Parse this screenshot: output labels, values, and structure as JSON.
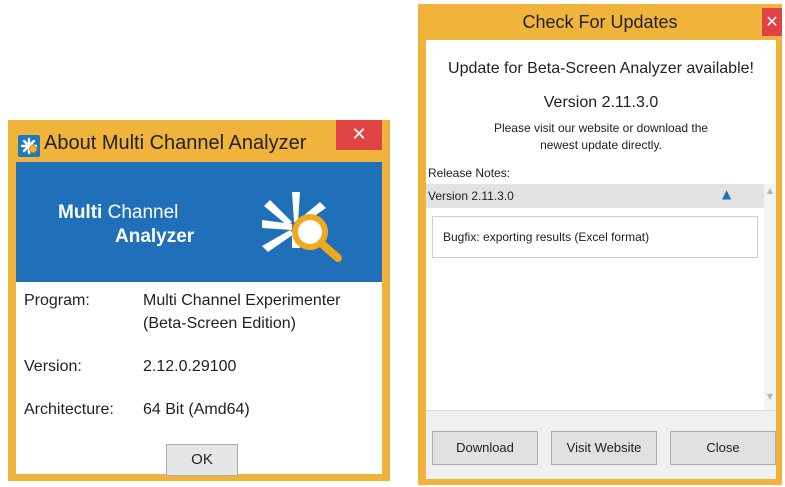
{
  "about": {
    "title": "About Multi Channel Analyzer",
    "close_glyph": "✕",
    "banner": {
      "multi_bold": "Multi",
      "multi_light": "Channel",
      "analyzer": "Analyzer"
    },
    "rows": [
      {
        "label": "Program:",
        "value_line1": "Multi Channel Experimenter",
        "value_line2": "(Beta-Screen Edition)"
      },
      {
        "label": "Version:",
        "value": "2.12.0.29100"
      },
      {
        "label": "Architecture:",
        "value": "64 Bit (Amd64)"
      }
    ],
    "ok_label": "OK",
    "colors": {
      "frame": "#f0b43c",
      "banner": "#1f6fb9",
      "close": "#e04343"
    }
  },
  "updates": {
    "title": "Check For Updates",
    "close_glyph": "✕",
    "heading": "Update for Beta-Screen Analyzer available!",
    "version": "Version 2.11.3.0",
    "desc_line1": "Please visit our website or download the",
    "desc_line2": "newest update directly.",
    "notes_label": "Release Notes:",
    "notes_header": "Version 2.11.3.0",
    "notes_item": "Bugfix: exporting results (Excel format)",
    "buttons": {
      "download": "Download",
      "visit": "Visit Website",
      "close": "Close"
    },
    "icons": {
      "expand": "chevron-up-icon",
      "scroll_up": "scroll-up-arrow-icon",
      "scroll_down": "scroll-down-arrow-icon"
    }
  }
}
